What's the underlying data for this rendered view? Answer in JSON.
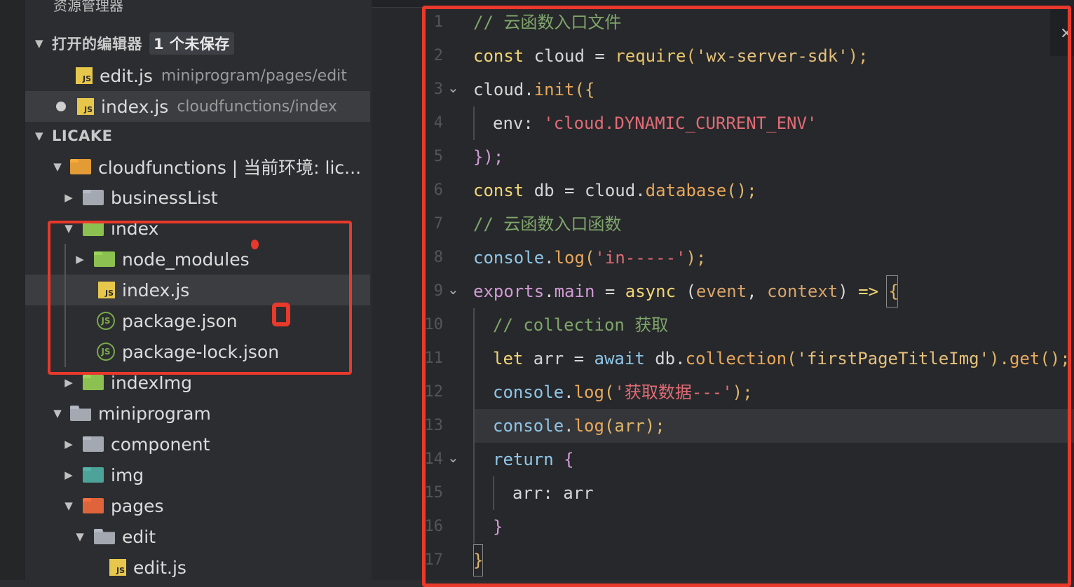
{
  "sidebar": {
    "title": "资源管理器",
    "open_editors": {
      "label": "打开的编辑器",
      "badge": "1 个未保存"
    },
    "open_files": [
      {
        "name": "edit.js",
        "path": "miniprogram/pages/edit"
      },
      {
        "name": "index.js",
        "path": "cloudfunctions/index"
      }
    ],
    "project": "LICAKE",
    "tree": {
      "cloudfunctions": "cloudfunctions | 当前环境: lic...",
      "businessList": "businessList",
      "index": "index",
      "node_modules": "node_modules",
      "index_js": "index.js",
      "package_json": "package.json",
      "package_lock": "package-lock.json",
      "indexImg": "indexImg",
      "miniprogram": "miniprogram",
      "component": "component",
      "img": "img",
      "pages": "pages",
      "edit": "edit",
      "edit_js": "edit.js"
    },
    "icons": {
      "js": "JS",
      "json": "JS"
    }
  },
  "editor": {
    "lines": [
      "1",
      "2",
      "3",
      "4",
      "5",
      "6",
      "7",
      "8",
      "9",
      "10",
      "11",
      "12",
      "13",
      "14",
      "15",
      "16",
      "17"
    ],
    "code": {
      "l1": "// 云函数入口文件",
      "l2a": "const",
      "l2b": " cloud = ",
      "l2c": "require",
      "l2d": "(",
      "l2e": "'wx-server-sdk'",
      "l2f": ");",
      "l3a": "cloud",
      "l3b": ".",
      "l3c": "init",
      "l3d": "({",
      "l4a": "env: ",
      "l4b": "'cloud.DYNAMIC_CURRENT_ENV'",
      "l5": "});",
      "l6a": "const",
      "l6b": " db = cloud.",
      "l6c": "database",
      "l6d": "();",
      "l7": "// 云函数入口函数",
      "l8a": "console",
      "l8b": ".",
      "l8c": "log",
      "l8d": "(",
      "l8e": "'in-----'",
      "l8f": ");",
      "l9a": "exports",
      "l9b": ".",
      "l9c": "main",
      "l9d": " = ",
      "l9e": "async",
      "l9f": " (",
      "l9g": "event",
      "l9h": ", ",
      "l9i": "context",
      "l9j": ") ",
      "l9k": "=>",
      "l9l": " {",
      "l10": "// collection 获取",
      "l11a": "let",
      "l11b": " arr = ",
      "l11c": "await",
      "l11d": " db.",
      "l11e": "collection",
      "l11f": "(",
      "l11g": "'firstPageTitleImg'",
      "l11h": ").",
      "l11i": "get",
      "l11j": "();",
      "l12a": "console",
      "l12b": ".",
      "l12c": "log",
      "l12d": "(",
      "l12e": "'获取数据---'",
      "l12f": ");",
      "l13a": "console",
      "l13b": ".",
      "l13c": "log",
      "l13d": "(arr);",
      "l14a": "return",
      "l14b": " {",
      "l15": "arr: arr",
      "l16": "}",
      "l17": "}"
    }
  },
  "colors": {
    "annotation": "#e8392b"
  }
}
